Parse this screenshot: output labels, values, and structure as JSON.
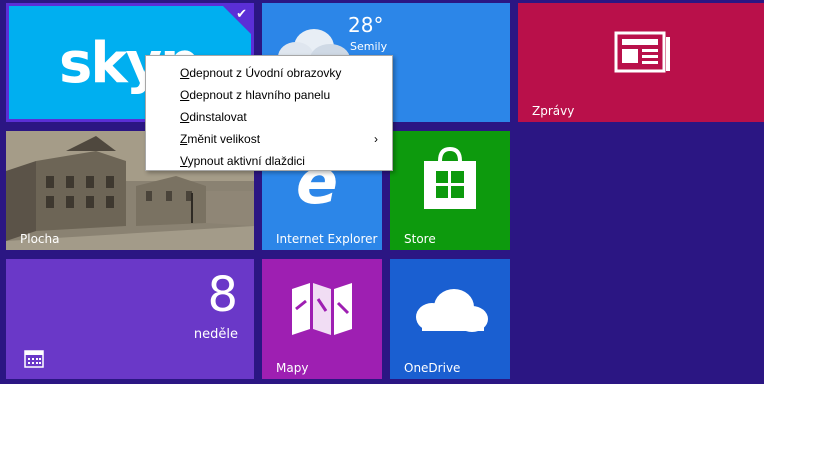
{
  "tiles": {
    "weather": {
      "temperature": "28°",
      "city": "Semily"
    },
    "news": {
      "label": "Zprávy"
    },
    "desktop": {
      "label": "Plocha"
    },
    "ie": {
      "label": "Internet Explorer"
    },
    "store": {
      "label": "Store"
    },
    "calendar": {
      "day": "8",
      "weekday": "neděle"
    },
    "maps": {
      "label": "Mapy"
    },
    "onedrive": {
      "label": "OneDrive"
    }
  },
  "context_menu": {
    "items": [
      {
        "access": "O",
        "rest": "depnout z Úvodní obrazovky"
      },
      {
        "access": "O",
        "rest": "depnout z hlavního panelu"
      },
      {
        "access": "O",
        "rest": "dinstalovat"
      },
      {
        "access": "Z",
        "rest": "měnit velikost",
        "submenu": true
      },
      {
        "access": "V",
        "rest": "ypnout aktivní dlaždici"
      }
    ]
  },
  "colors": {
    "background": "#2b1683",
    "skype": "#00aff0",
    "selection": "#5b2fd6",
    "weather": "#2c86e8",
    "news": "#b9104a",
    "store": "#0d9a0d",
    "calendar": "#6a38c8",
    "maps": "#9e1fb2",
    "onedrive": "#1a5fd1"
  },
  "icons": {
    "skype": "skype-logo",
    "weather": "cloud-icon",
    "news": "newspaper-icon",
    "ie": "internet-explorer-icon",
    "store": "store-bag-icon",
    "calendar": "calendar-icon",
    "maps": "map-icon",
    "onedrive": "onedrive-cloud-icon",
    "selected": "checkmark-icon",
    "submenu": "chevron-right-icon"
  }
}
